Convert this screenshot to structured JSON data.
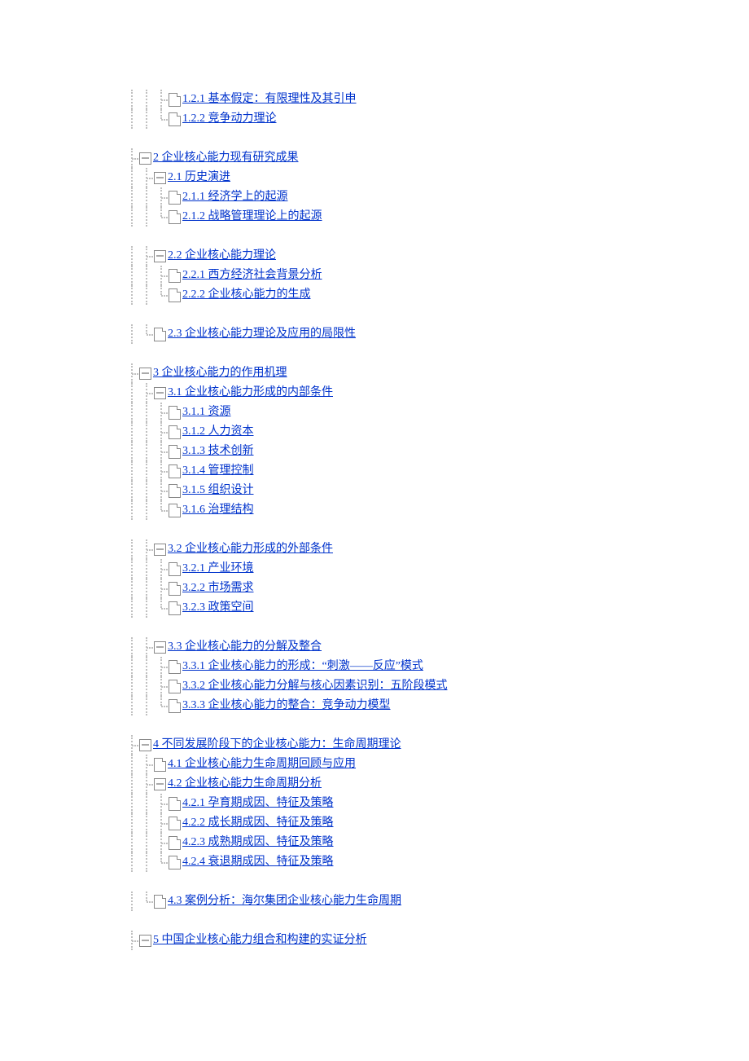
{
  "toc": [
    {
      "depth": 2,
      "type": "leaf",
      "last": false,
      "pipes": [
        true,
        true
      ],
      "label": "1.2.1 基本假定：有限理性及其引申"
    },
    {
      "depth": 2,
      "type": "leaf",
      "last": true,
      "pipes": [
        true,
        true
      ],
      "label": "1.2.2 竞争动力理论"
    },
    {
      "depth": 0,
      "type": "spacer"
    },
    {
      "depth": 0,
      "type": "branch",
      "last": false,
      "pipes": [],
      "label": "2 企业核心能力现有研究成果 "
    },
    {
      "depth": 1,
      "type": "branch",
      "last": false,
      "pipes": [
        true
      ],
      "label": "2.1 历史演进"
    },
    {
      "depth": 2,
      "type": "leaf",
      "last": false,
      "pipes": [
        true,
        true
      ],
      "label": "2.1.1 经济学上的起源"
    },
    {
      "depth": 2,
      "type": "leaf",
      "last": true,
      "pipes": [
        true,
        true
      ],
      "label": "2.1.2 战略管理理论上的起源"
    },
    {
      "depth": 0,
      "type": "spacer"
    },
    {
      "depth": 1,
      "type": "branch",
      "last": false,
      "pipes": [
        true
      ],
      "label": "2.2 企业核心能力理论"
    },
    {
      "depth": 2,
      "type": "leaf",
      "last": false,
      "pipes": [
        true,
        true
      ],
      "label": "2.2.1 西方经济社会背景分析"
    },
    {
      "depth": 2,
      "type": "leaf",
      "last": true,
      "pipes": [
        true,
        true
      ],
      "label": "2.2.2 企业核心能力的生成"
    },
    {
      "depth": 0,
      "type": "spacer"
    },
    {
      "depth": 1,
      "type": "leaf",
      "last": true,
      "pipes": [
        true
      ],
      "label": "2.3 企业核心能力理论及应用的局限性"
    },
    {
      "depth": 0,
      "type": "spacer"
    },
    {
      "depth": 0,
      "type": "branch",
      "last": false,
      "pipes": [],
      "label": "3 企业核心能力的作用机理"
    },
    {
      "depth": 1,
      "type": "branch",
      "last": false,
      "pipes": [
        true
      ],
      "label": "3.1 企业核心能力形成的内部条件"
    },
    {
      "depth": 2,
      "type": "leaf",
      "last": false,
      "pipes": [
        true,
        true
      ],
      "label": "3.1.1 资源"
    },
    {
      "depth": 2,
      "type": "leaf",
      "last": false,
      "pipes": [
        true,
        true
      ],
      "label": "3.1.2 人力资本"
    },
    {
      "depth": 2,
      "type": "leaf",
      "last": false,
      "pipes": [
        true,
        true
      ],
      "label": "3.1.3 技术创新"
    },
    {
      "depth": 2,
      "type": "leaf",
      "last": false,
      "pipes": [
        true,
        true
      ],
      "label": "3.1.4 管理控制"
    },
    {
      "depth": 2,
      "type": "leaf",
      "last": false,
      "pipes": [
        true,
        true
      ],
      "label": "3.1.5 组织设计"
    },
    {
      "depth": 2,
      "type": "leaf",
      "last": true,
      "pipes": [
        true,
        true
      ],
      "label": "3.1.6 治理结构"
    },
    {
      "depth": 0,
      "type": "spacer"
    },
    {
      "depth": 1,
      "type": "branch",
      "last": false,
      "pipes": [
        true
      ],
      "label": "3.2 企业核心能力形成的外部条件"
    },
    {
      "depth": 2,
      "type": "leaf",
      "last": false,
      "pipes": [
        true,
        true
      ],
      "label": "3.2.1 产业环境"
    },
    {
      "depth": 2,
      "type": "leaf",
      "last": false,
      "pipes": [
        true,
        true
      ],
      "label": "3.2.2 市场需求"
    },
    {
      "depth": 2,
      "type": "leaf",
      "last": true,
      "pipes": [
        true,
        true
      ],
      "label": "3.2.3 政策空间"
    },
    {
      "depth": 0,
      "type": "spacer"
    },
    {
      "depth": 1,
      "type": "branch",
      "last": false,
      "pipes": [
        true
      ],
      "label": "3.3 企业核心能力的分解及整合"
    },
    {
      "depth": 2,
      "type": "leaf",
      "last": false,
      "pipes": [
        true,
        true
      ],
      "label": "3.3.1 企业核心能力的形成：“刺激——反应”模式"
    },
    {
      "depth": 2,
      "type": "leaf",
      "last": false,
      "pipes": [
        true,
        true
      ],
      "label": "3.3.2 企业核心能力分解与核心因素识别：五阶段模式"
    },
    {
      "depth": 2,
      "type": "leaf",
      "last": true,
      "pipes": [
        true,
        true
      ],
      "label": "3.3.3 企业核心能力的整合：竞争动力模型"
    },
    {
      "depth": 0,
      "type": "spacer"
    },
    {
      "depth": 0,
      "type": "branch",
      "last": false,
      "pipes": [],
      "label": "4 不同发展阶段下的企业核心能力：生命周期理论"
    },
    {
      "depth": 1,
      "type": "leaf",
      "last": false,
      "pipes": [
        true
      ],
      "label": "4.1 企业核心能力生命周期回顾与应用"
    },
    {
      "depth": 1,
      "type": "branch",
      "last": false,
      "pipes": [
        true
      ],
      "label": "4.2 企业核心能力生命周期分析"
    },
    {
      "depth": 2,
      "type": "leaf",
      "last": false,
      "pipes": [
        true,
        true
      ],
      "label": "4.2.1 孕育期成因、特征及策略"
    },
    {
      "depth": 2,
      "type": "leaf",
      "last": false,
      "pipes": [
        true,
        true
      ],
      "label": "4.2.2 成长期成因、特征及策略"
    },
    {
      "depth": 2,
      "type": "leaf",
      "last": false,
      "pipes": [
        true,
        true
      ],
      "label": "4.2.3 成熟期成因、特征及策略"
    },
    {
      "depth": 2,
      "type": "leaf",
      "last": true,
      "pipes": [
        true,
        true
      ],
      "label": "4.2.4 衰退期成因、特征及策略"
    },
    {
      "depth": 0,
      "type": "spacer"
    },
    {
      "depth": 1,
      "type": "leaf",
      "last": true,
      "pipes": [
        true
      ],
      "label": "4.3 案例分析：海尔集团企业核心能力生命周期"
    },
    {
      "depth": 0,
      "type": "spacer"
    },
    {
      "depth": 0,
      "type": "branch",
      "last": false,
      "pipes": [],
      "label": "5 中国企业核心能力组合和构建的实证分析"
    }
  ]
}
